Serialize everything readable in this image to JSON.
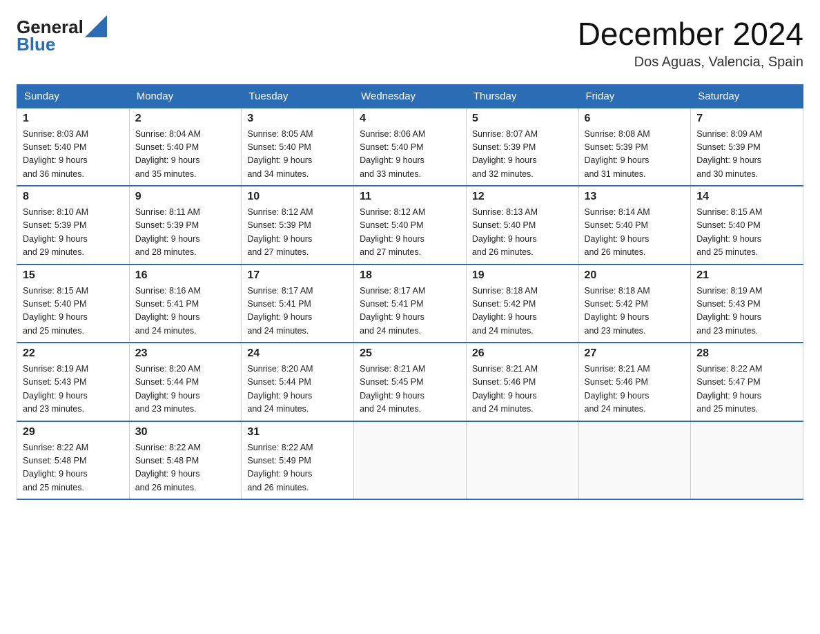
{
  "header": {
    "logo_general": "General",
    "logo_blue": "Blue",
    "month_year": "December 2024",
    "location": "Dos Aguas, Valencia, Spain"
  },
  "days_of_week": [
    "Sunday",
    "Monday",
    "Tuesday",
    "Wednesday",
    "Thursday",
    "Friday",
    "Saturday"
  ],
  "weeks": [
    [
      {
        "day": 1,
        "sunrise": "8:03 AM",
        "sunset": "5:40 PM",
        "daylight": "9 hours and 36 minutes."
      },
      {
        "day": 2,
        "sunrise": "8:04 AM",
        "sunset": "5:40 PM",
        "daylight": "9 hours and 35 minutes."
      },
      {
        "day": 3,
        "sunrise": "8:05 AM",
        "sunset": "5:40 PM",
        "daylight": "9 hours and 34 minutes."
      },
      {
        "day": 4,
        "sunrise": "8:06 AM",
        "sunset": "5:40 PM",
        "daylight": "9 hours and 33 minutes."
      },
      {
        "day": 5,
        "sunrise": "8:07 AM",
        "sunset": "5:39 PM",
        "daylight": "9 hours and 32 minutes."
      },
      {
        "day": 6,
        "sunrise": "8:08 AM",
        "sunset": "5:39 PM",
        "daylight": "9 hours and 31 minutes."
      },
      {
        "day": 7,
        "sunrise": "8:09 AM",
        "sunset": "5:39 PM",
        "daylight": "9 hours and 30 minutes."
      }
    ],
    [
      {
        "day": 8,
        "sunrise": "8:10 AM",
        "sunset": "5:39 PM",
        "daylight": "9 hours and 29 minutes."
      },
      {
        "day": 9,
        "sunrise": "8:11 AM",
        "sunset": "5:39 PM",
        "daylight": "9 hours and 28 minutes."
      },
      {
        "day": 10,
        "sunrise": "8:12 AM",
        "sunset": "5:39 PM",
        "daylight": "9 hours and 27 minutes."
      },
      {
        "day": 11,
        "sunrise": "8:12 AM",
        "sunset": "5:40 PM",
        "daylight": "9 hours and 27 minutes."
      },
      {
        "day": 12,
        "sunrise": "8:13 AM",
        "sunset": "5:40 PM",
        "daylight": "9 hours and 26 minutes."
      },
      {
        "day": 13,
        "sunrise": "8:14 AM",
        "sunset": "5:40 PM",
        "daylight": "9 hours and 26 minutes."
      },
      {
        "day": 14,
        "sunrise": "8:15 AM",
        "sunset": "5:40 PM",
        "daylight": "9 hours and 25 minutes."
      }
    ],
    [
      {
        "day": 15,
        "sunrise": "8:15 AM",
        "sunset": "5:40 PM",
        "daylight": "9 hours and 25 minutes."
      },
      {
        "day": 16,
        "sunrise": "8:16 AM",
        "sunset": "5:41 PM",
        "daylight": "9 hours and 24 minutes."
      },
      {
        "day": 17,
        "sunrise": "8:17 AM",
        "sunset": "5:41 PM",
        "daylight": "9 hours and 24 minutes."
      },
      {
        "day": 18,
        "sunrise": "8:17 AM",
        "sunset": "5:41 PM",
        "daylight": "9 hours and 24 minutes."
      },
      {
        "day": 19,
        "sunrise": "8:18 AM",
        "sunset": "5:42 PM",
        "daylight": "9 hours and 24 minutes."
      },
      {
        "day": 20,
        "sunrise": "8:18 AM",
        "sunset": "5:42 PM",
        "daylight": "9 hours and 23 minutes."
      },
      {
        "day": 21,
        "sunrise": "8:19 AM",
        "sunset": "5:43 PM",
        "daylight": "9 hours and 23 minutes."
      }
    ],
    [
      {
        "day": 22,
        "sunrise": "8:19 AM",
        "sunset": "5:43 PM",
        "daylight": "9 hours and 23 minutes."
      },
      {
        "day": 23,
        "sunrise": "8:20 AM",
        "sunset": "5:44 PM",
        "daylight": "9 hours and 23 minutes."
      },
      {
        "day": 24,
        "sunrise": "8:20 AM",
        "sunset": "5:44 PM",
        "daylight": "9 hours and 24 minutes."
      },
      {
        "day": 25,
        "sunrise": "8:21 AM",
        "sunset": "5:45 PM",
        "daylight": "9 hours and 24 minutes."
      },
      {
        "day": 26,
        "sunrise": "8:21 AM",
        "sunset": "5:46 PM",
        "daylight": "9 hours and 24 minutes."
      },
      {
        "day": 27,
        "sunrise": "8:21 AM",
        "sunset": "5:46 PM",
        "daylight": "9 hours and 24 minutes."
      },
      {
        "day": 28,
        "sunrise": "8:22 AM",
        "sunset": "5:47 PM",
        "daylight": "9 hours and 25 minutes."
      }
    ],
    [
      {
        "day": 29,
        "sunrise": "8:22 AM",
        "sunset": "5:48 PM",
        "daylight": "9 hours and 25 minutes."
      },
      {
        "day": 30,
        "sunrise": "8:22 AM",
        "sunset": "5:48 PM",
        "daylight": "9 hours and 26 minutes."
      },
      {
        "day": 31,
        "sunrise": "8:22 AM",
        "sunset": "5:49 PM",
        "daylight": "9 hours and 26 minutes."
      },
      null,
      null,
      null,
      null
    ]
  ],
  "labels": {
    "sunrise": "Sunrise:",
    "sunset": "Sunset:",
    "daylight": "Daylight:"
  }
}
